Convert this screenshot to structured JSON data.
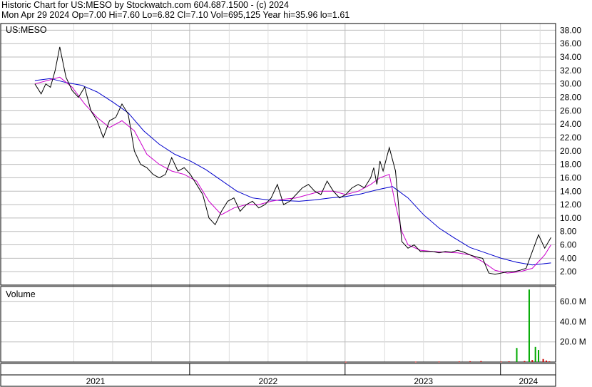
{
  "header": {
    "line1": "Historic Chart for US:MESO by Stockwatch.com 604.687.1500 - (c) 2024",
    "line2": "Mon Apr 29 2024  Op=7.00  Hi=7.60  Lo=6.82  Cl=7.10  Vol=695,125  Year hi=35.96  lo=1.61"
  },
  "colors": {
    "price": "#000000",
    "ma_short": "#cc00cc",
    "ma_long": "#0000cc",
    "volume_up": "#00aa00",
    "volume_down": "#cc0000",
    "grid": "#bbbbbb"
  },
  "chart_data": [
    {
      "type": "line",
      "panel_label": "US:MESO",
      "x_labels": [
        "2021",
        "2022",
        "2023",
        "2024"
      ],
      "ylim": [
        0,
        39
      ],
      "yticks": [
        "2.00",
        "4.00",
        "6.00",
        "8.00",
        "10.00",
        "12.00",
        "14.00",
        "16.00",
        "18.00",
        "20.00",
        "22.00",
        "24.00",
        "26.00",
        "28.00",
        "30.00",
        "32.00",
        "34.00",
        "36.00",
        "38.00"
      ],
      "grid": true,
      "series": [
        {
          "x": [
            2021.0,
            2021.04,
            2021.07,
            2021.1,
            2021.13,
            2021.16,
            2021.2,
            2021.24,
            2021.28,
            2021.32,
            2021.36,
            2021.4,
            2021.44,
            2021.48,
            2021.52,
            2021.56,
            2021.6,
            2021.64,
            2021.68,
            2021.72,
            2021.76,
            2021.8,
            2021.84,
            2021.88,
            2021.92,
            2021.96,
            2022.0,
            2022.04,
            2022.08,
            2022.12,
            2022.16,
            2022.2,
            2022.24,
            2022.28,
            2022.32,
            2022.36,
            2022.4,
            2022.44,
            2022.48,
            2022.52,
            2022.56,
            2022.6,
            2022.64,
            2022.68,
            2022.72,
            2022.76,
            2022.8,
            2022.84,
            2022.88,
            2022.92,
            2022.96,
            2023.0,
            2023.04,
            2023.08,
            2023.12,
            2023.16,
            2023.18,
            2023.2,
            2023.22,
            2023.24,
            2023.28,
            2023.32,
            2023.36,
            2023.4,
            2023.44,
            2023.48,
            2023.52,
            2023.56,
            2023.6,
            2023.64,
            2023.68,
            2023.72,
            2023.76,
            2023.8,
            2023.84,
            2023.88,
            2023.92,
            2023.96,
            2024.0,
            2024.04,
            2024.08,
            2024.12,
            2024.16,
            2024.2,
            2024.24,
            2024.28,
            2024.32
          ],
          "values": [
            30.0,
            28.5,
            30.0,
            29.5,
            32.0,
            35.5,
            31.0,
            29.0,
            28.0,
            29.5,
            26.0,
            24.5,
            22.0,
            24.5,
            25.0,
            27.0,
            25.5,
            20.0,
            18.0,
            17.5,
            16.5,
            16.0,
            16.5,
            19.0,
            17.0,
            17.5,
            16.5,
            15.0,
            13.5,
            10.0,
            9.0,
            11.0,
            12.5,
            13.0,
            11.0,
            12.0,
            12.5,
            11.5,
            12.0,
            13.0,
            15.0,
            12.0,
            12.5,
            13.5,
            14.5,
            15.0,
            14.0,
            13.5,
            15.5,
            14.0,
            13.0,
            13.5,
            14.5,
            15.0,
            14.5,
            16.0,
            17.5,
            15.0,
            18.5,
            17.0,
            20.5,
            17.0,
            6.5,
            5.5,
            6.0,
            5.0,
            5.0,
            5.0,
            4.8,
            5.0,
            4.9,
            5.2,
            4.9,
            4.5,
            4.2,
            4.0,
            1.8,
            1.6,
            1.8,
            2.0,
            2.0,
            2.2,
            2.5,
            5.0,
            7.5,
            5.5,
            7.1
          ]
        },
        {
          "x": [
            2021.0,
            2021.08,
            2021.16,
            2021.24,
            2021.32,
            2021.4,
            2021.48,
            2021.56,
            2021.64,
            2021.72,
            2021.8,
            2021.88,
            2021.96,
            2022.04,
            2022.12,
            2022.2,
            2022.28,
            2022.36,
            2022.44,
            2022.52,
            2022.6,
            2022.68,
            2022.76,
            2022.84,
            2022.92,
            2023.0,
            2023.08,
            2023.16,
            2023.22,
            2023.28,
            2023.32,
            2023.36,
            2023.4,
            2023.48,
            2023.56,
            2023.64,
            2023.72,
            2023.8,
            2023.88,
            2023.96,
            2024.04,
            2024.12,
            2024.2,
            2024.28,
            2024.32
          ],
          "values": [
            30.0,
            30.5,
            31.0,
            29.5,
            27.0,
            25.0,
            23.5,
            24.5,
            23.0,
            19.5,
            18.0,
            17.0,
            16.5,
            15.5,
            12.5,
            10.5,
            11.5,
            12.0,
            12.0,
            12.5,
            12.8,
            13.0,
            13.5,
            14.0,
            14.0,
            13.5,
            14.0,
            15.0,
            16.0,
            16.5,
            12.0,
            8.0,
            6.0,
            5.2,
            5.0,
            4.9,
            4.8,
            4.5,
            3.5,
            2.2,
            1.8,
            2.0,
            2.5,
            4.5,
            6.0
          ]
        },
        {
          "x": [
            2021.0,
            2021.1,
            2021.2,
            2021.3,
            2021.4,
            2021.5,
            2021.6,
            2021.7,
            2021.8,
            2021.9,
            2022.0,
            2022.1,
            2022.2,
            2022.3,
            2022.4,
            2022.5,
            2022.6,
            2022.7,
            2022.8,
            2022.9,
            2023.0,
            2023.1,
            2023.2,
            2023.3,
            2023.4,
            2023.5,
            2023.6,
            2023.7,
            2023.8,
            2023.9,
            2024.0,
            2024.1,
            2024.2,
            2024.32
          ],
          "values": [
            30.5,
            30.8,
            30.2,
            29.8,
            28.8,
            27.3,
            25.7,
            23.0,
            21.0,
            19.5,
            18.5,
            17.2,
            15.6,
            14.0,
            13.0,
            12.7,
            12.6,
            12.5,
            12.7,
            13.0,
            13.2,
            13.6,
            14.2,
            14.7,
            13.0,
            10.5,
            8.5,
            7.0,
            5.6,
            4.8,
            4.0,
            3.4,
            3.0,
            3.3
          ]
        }
      ]
    },
    {
      "type": "bar",
      "panel_label": "Volume",
      "ylim": [
        0,
        75
      ],
      "yticks": [
        "20.0 M",
        "40.0 M",
        "60.0 M"
      ],
      "x": [
        2023.0,
        2023.45,
        2023.6,
        2023.73,
        2023.8,
        2023.87,
        2024.0,
        2024.05,
        2024.1,
        2024.15,
        2024.18,
        2024.2,
        2024.22,
        2024.24,
        2024.27,
        2024.29,
        2024.31
      ],
      "values": [
        0.3,
        0.4,
        0.5,
        0.6,
        0.8,
        1.0,
        0.5,
        0.7,
        14.0,
        1.0,
        72.0,
        2.0,
        15.0,
        12.0,
        3.0,
        1.5,
        0.7
      ]
    }
  ]
}
